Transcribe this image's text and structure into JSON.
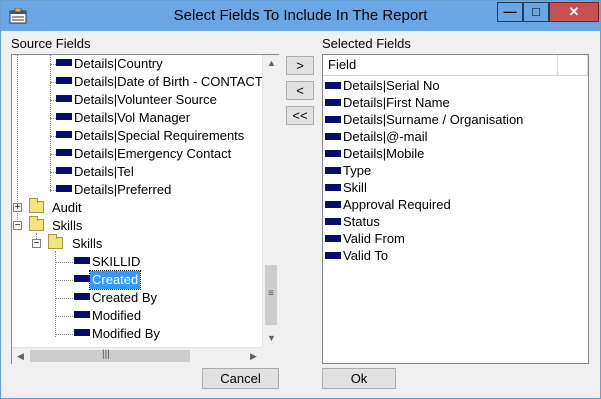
{
  "window": {
    "title": "Select Fields To Include In The Report",
    "buttons": {
      "minimize": "—",
      "maximize": "□",
      "close": "✕"
    }
  },
  "source": {
    "label": "Source Fields",
    "tree": [
      {
        "text": "Details|Country",
        "icon": "field"
      },
      {
        "text": "Details|Date of Birth - CONTACT",
        "icon": "field"
      },
      {
        "text": "Details|Volunteer Source",
        "icon": "field"
      },
      {
        "text": "Details|Vol Manager",
        "icon": "field"
      },
      {
        "text": "Details|Special Requirements",
        "icon": "field"
      },
      {
        "text": "Details|Emergency Contact",
        "icon": "field"
      },
      {
        "text": "Details|Tel",
        "icon": "field"
      },
      {
        "text": "Details|Preferred",
        "icon": "field"
      },
      {
        "text": "Audit",
        "icon": "folder",
        "expander": "+"
      },
      {
        "text": "Skills",
        "icon": "folder",
        "expander": "−"
      },
      {
        "text": "Skills",
        "icon": "folder",
        "expander": "−"
      },
      {
        "text": "SKILLID",
        "icon": "field"
      },
      {
        "text": "Created",
        "icon": "field",
        "selected": true
      },
      {
        "text": "Created By",
        "icon": "field"
      },
      {
        "text": "Modified",
        "icon": "field"
      },
      {
        "text": "Modified By",
        "icon": "field"
      }
    ]
  },
  "move_buttons": {
    "add": ">",
    "remove": "<",
    "remove_all": "<<"
  },
  "selected": {
    "label": "Selected Fields",
    "header": "Field",
    "rows": [
      "Details|Serial No",
      "Details|First Name",
      "Details|Surname / Organisation",
      "Details|@-mail",
      "Details|Mobile",
      "Type",
      "Skill",
      "Approval Required",
      "Status",
      "Valid From",
      "Valid To"
    ]
  },
  "footer": {
    "cancel": "Cancel",
    "ok": "Ok"
  },
  "colors": {
    "titlebar": "#6aa6e4",
    "close": "#c75050",
    "selection": "#3399ff",
    "field_icon": "#0a0a6e"
  }
}
